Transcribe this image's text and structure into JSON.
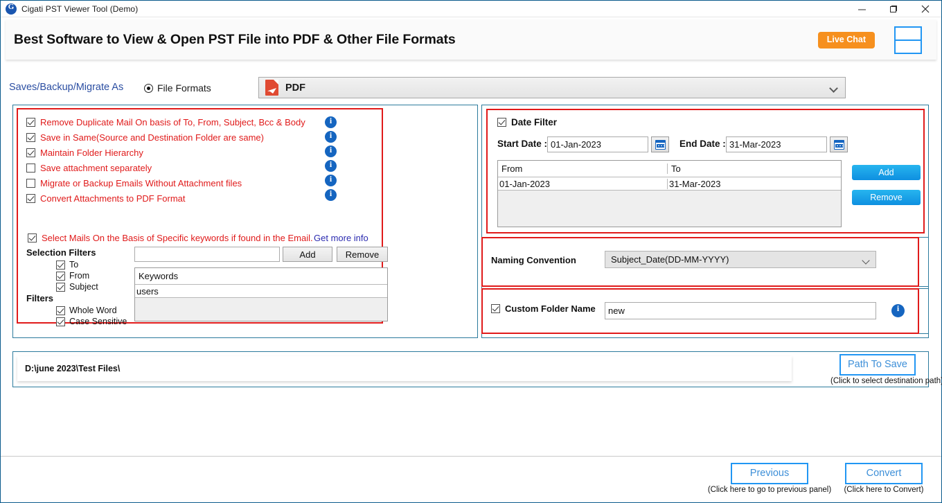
{
  "window": {
    "title": "Cigati PST Viewer Tool (Demo)",
    "minimize": "minimize-icon",
    "maximize": "maximize-icon",
    "close": "close-icon"
  },
  "header": {
    "title": "Best Software to View & Open PST File into PDF & Other File Formats",
    "live_chat": "Live Chat",
    "menu": "hamburger-icon",
    "accent_orange": "#f6901e",
    "accent_blue": "#2196f3"
  },
  "format_row": {
    "save_as_label": "Saves/Backup/Migrate As",
    "radio_label": "File Formats",
    "selected_format": "PDF"
  },
  "options": {
    "items": [
      {
        "label": "Remove Duplicate Mail On basis of To, From, Subject, Bcc & Body",
        "checked": true
      },
      {
        "label": "Save in Same(Source and Destination Folder are same)",
        "checked": true
      },
      {
        "label": "Maintain Folder Hierarchy",
        "checked": true
      },
      {
        "label": "Save attachment separately",
        "checked": false
      },
      {
        "label": "Migrate or Backup Emails Without Attachment files",
        "checked": false
      },
      {
        "label": "Convert Attachments to PDF Format",
        "checked": true
      }
    ],
    "info_icon": "info-icon",
    "text_color": "#e01a1a"
  },
  "keywords": {
    "header_label": "Select Mails On the Basis of Specific keywords if found in the Email.",
    "header_checked": true,
    "get_more_info": "Get more info",
    "selection_filters_title": "Selection Filters",
    "selection_filters": [
      {
        "label": "To",
        "checked": true
      },
      {
        "label": "From",
        "checked": true
      },
      {
        "label": "Subject",
        "checked": true
      }
    ],
    "filters_title": "Filters",
    "filters": [
      {
        "label": "Whole Word",
        "checked": true
      },
      {
        "label": "Case Sensitive",
        "checked": true
      }
    ],
    "input_value": "",
    "input_placeholder": "",
    "add_label": "Add",
    "remove_label": "Remove",
    "grid_header": "Keywords",
    "grid_rows": [
      "users"
    ]
  },
  "date_filter": {
    "title": "Date Filter",
    "checked": true,
    "start_label": "Start Date :",
    "start_value": "01-Jan-2023",
    "end_label": "End Date :",
    "end_value": "31-Mar-2023",
    "calendar_icon": "calendar-icon",
    "columns": [
      "From",
      "To"
    ],
    "rows": [
      {
        "from": "01-Jan-2023",
        "to": "31-Mar-2023"
      }
    ],
    "add_label": "Add",
    "remove_label": "Remove"
  },
  "naming": {
    "label": "Naming Convention",
    "value": "Subject_Date(DD-MM-YYYY)"
  },
  "custom_folder": {
    "label": "Custom Folder Name",
    "checked": true,
    "value": "new",
    "info_icon": "info-icon"
  },
  "path": {
    "value": "D:\\june 2023\\Test Files\\",
    "button_label": "Path To Save",
    "button_hint": "(Click to select destination path)"
  },
  "footer": {
    "previous_label": "Previous",
    "previous_hint": "(Click here to go to previous panel)",
    "convert_label": "Convert",
    "convert_hint": "(Click here to Convert)"
  }
}
